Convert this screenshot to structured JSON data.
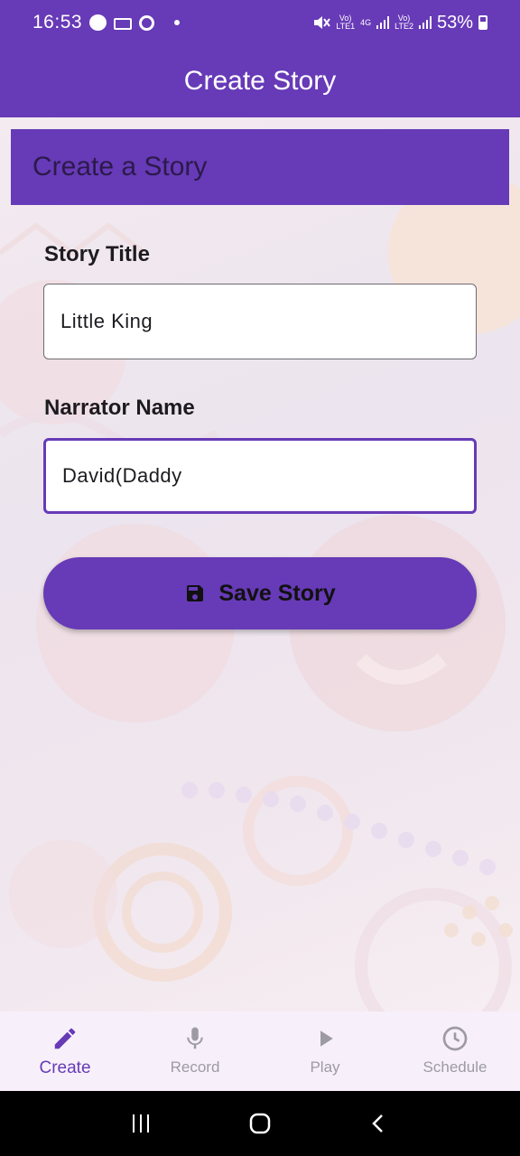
{
  "status_bar": {
    "time": "16:53",
    "battery": "53%",
    "sim1_top": "Vo)",
    "sim1_bottom": "LTE1",
    "network": "4G",
    "sim2_top": "Vo)",
    "sim2_bottom": "LTE2"
  },
  "app_bar": {
    "title": "Create Story"
  },
  "header": {
    "title": "Create a Story"
  },
  "form": {
    "story_title_label": "Story Title",
    "story_title_value": "Little King",
    "narrator_label": "Narrator Name",
    "narrator_value": "David(Daddy"
  },
  "save_button": {
    "label": "Save Story",
    "icon": "save-icon"
  },
  "bottom_nav": {
    "items": [
      {
        "label": "Create",
        "icon": "pencil-icon",
        "active": true
      },
      {
        "label": "Record",
        "icon": "microphone-icon",
        "active": false
      },
      {
        "label": "Play",
        "icon": "play-icon",
        "active": false
      },
      {
        "label": "Schedule",
        "icon": "clock-icon",
        "active": false
      }
    ]
  },
  "colors": {
    "primary": "#673ab7",
    "nav_background": "#f7f0fa",
    "inactive": "#9e9aa3"
  }
}
